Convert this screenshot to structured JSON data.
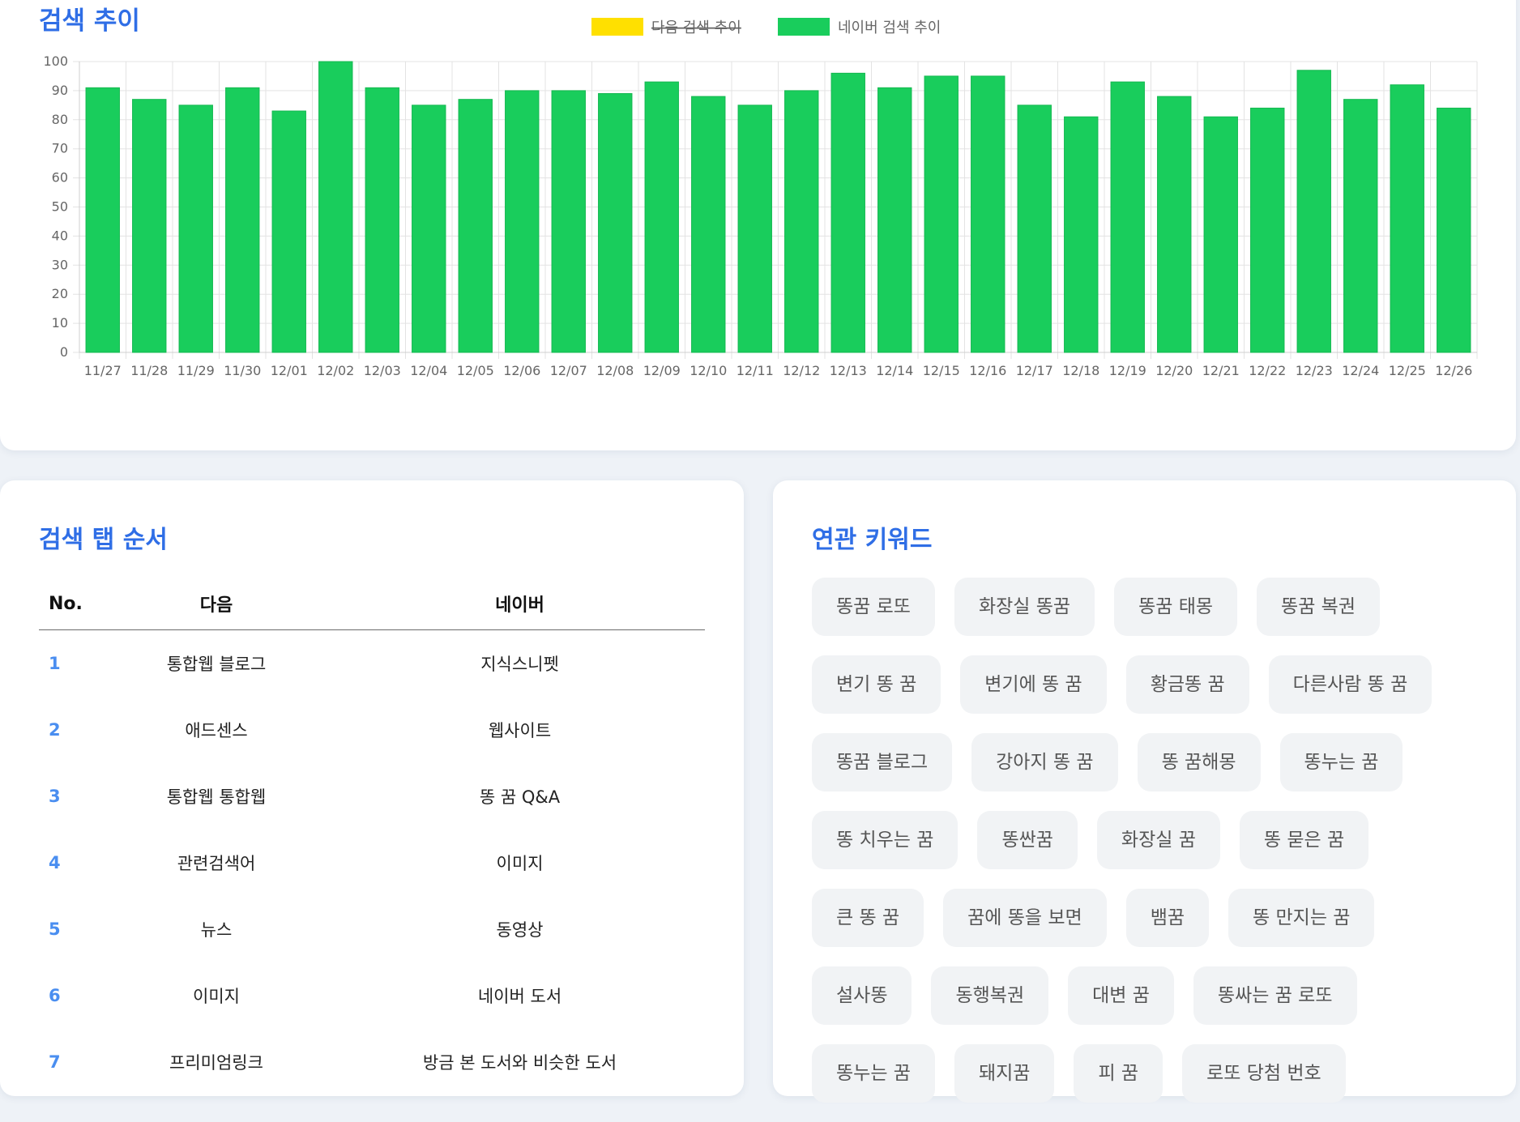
{
  "trend": {
    "title": "검색 추이",
    "chart_data": {
      "type": "bar",
      "title": "",
      "xlabel": "",
      "ylabel": "",
      "ylim": [
        0,
        100
      ],
      "yticks": [
        0,
        10,
        20,
        30,
        40,
        50,
        60,
        70,
        80,
        90,
        100
      ],
      "grid": true,
      "legend_position": "top",
      "categories": [
        "11/27",
        "11/28",
        "11/29",
        "11/30",
        "12/01",
        "12/02",
        "12/03",
        "12/04",
        "12/05",
        "12/06",
        "12/07",
        "12/08",
        "12/09",
        "12/10",
        "12/11",
        "12/12",
        "12/13",
        "12/14",
        "12/15",
        "12/16",
        "12/17",
        "12/18",
        "12/19",
        "12/20",
        "12/21",
        "12/22",
        "12/23",
        "12/24",
        "12/25",
        "12/26"
      ],
      "series": [
        {
          "name": "다음 검색 추이",
          "color": "#ffe000",
          "hidden": true,
          "values": []
        },
        {
          "name": "네이버 검색 추이",
          "color": "#19cd5c",
          "hidden": false,
          "values": [
            91,
            87,
            85,
            91,
            83,
            100,
            91,
            85,
            87,
            90,
            90,
            89,
            93,
            88,
            85,
            90,
            96,
            91,
            95,
            95,
            85,
            81,
            93,
            88,
            81,
            84,
            97,
            87,
            92,
            84
          ]
        }
      ]
    }
  },
  "tab_order": {
    "title": "검색 탭 순서",
    "columns": [
      "No.",
      "다음",
      "네이버"
    ],
    "rows": [
      {
        "no": "1",
        "daum": "통합웹 블로그",
        "naver": "지식스니펫"
      },
      {
        "no": "2",
        "daum": "애드센스",
        "naver": "웹사이트"
      },
      {
        "no": "3",
        "daum": "통합웹 통합웹",
        "naver": "똥 꿈 Q&A"
      },
      {
        "no": "4",
        "daum": "관련검색어",
        "naver": "이미지"
      },
      {
        "no": "5",
        "daum": "뉴스",
        "naver": "동영상"
      },
      {
        "no": "6",
        "daum": "이미지",
        "naver": "네이버 도서"
      },
      {
        "no": "7",
        "daum": "프리미엄링크",
        "naver": "방금 본 도서와 비슷한 도서"
      }
    ]
  },
  "keywords": {
    "title": "연관 키워드",
    "rows": [
      [
        "똥꿈 로또",
        "화장실 똥꿈",
        "똥꿈 태몽",
        "똥꿈 복권"
      ],
      [
        "변기 똥 꿈",
        "변기에 똥 꿈",
        "황금똥 꿈",
        "다른사람 똥 꿈"
      ],
      [
        "똥꿈 블로그",
        "강아지 똥 꿈",
        "똥 꿈해몽",
        "똥누는 꿈"
      ],
      [
        "똥 치우는 꿈",
        "똥싼꿈",
        "화장실 꿈",
        "똥 묻은 꿈"
      ],
      [
        "큰 똥 꿈",
        "꿈에 똥을 보면",
        "뱀꿈",
        "똥 만지는 꿈"
      ],
      [
        "설사똥",
        "동행복권",
        "대변 꿈",
        "똥싸는 꿈 로또"
      ],
      [
        "똥누는 꿈",
        "돼지꿈",
        "피 꿈",
        "로또 당첨 번호"
      ]
    ]
  }
}
